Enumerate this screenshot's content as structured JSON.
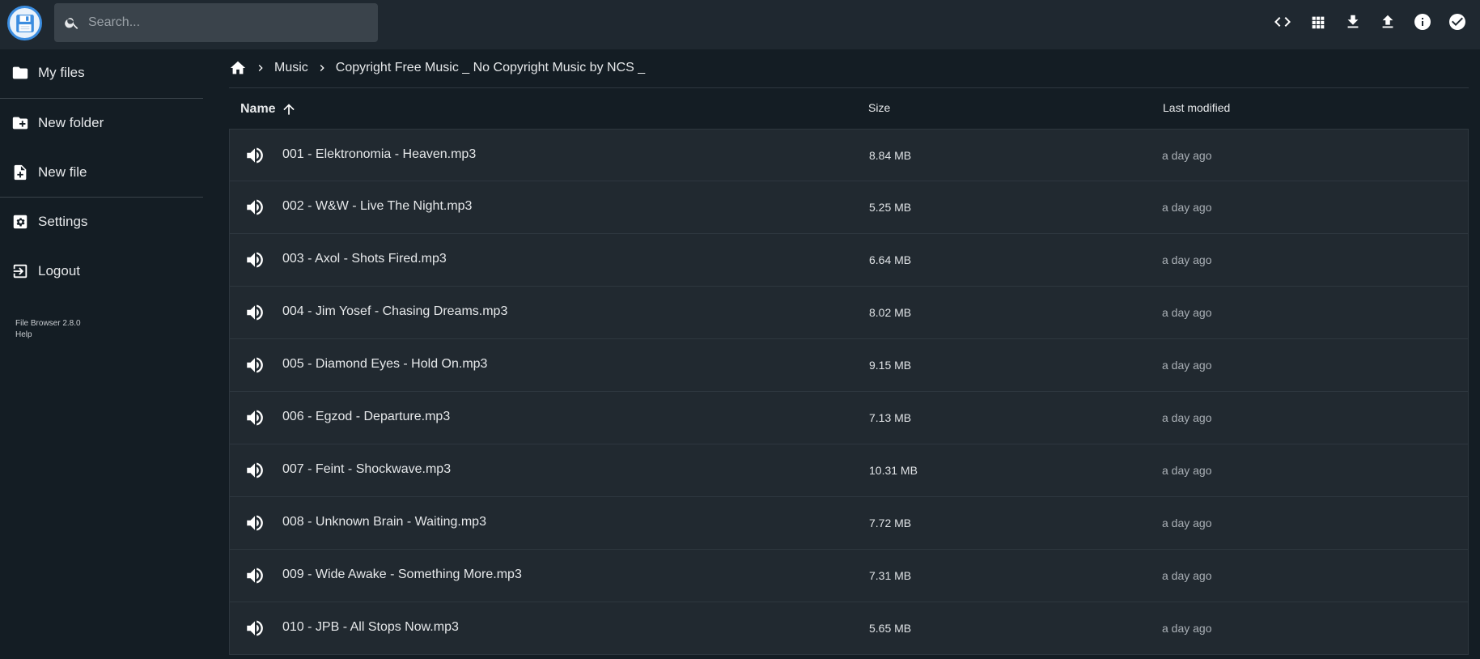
{
  "header": {
    "logo_icon": "floppy-disk-logo",
    "search": {
      "placeholder": "Search..."
    },
    "actions": [
      {
        "name": "code-icon"
      },
      {
        "name": "grid-view-icon"
      },
      {
        "name": "download-icon"
      },
      {
        "name": "upload-icon"
      },
      {
        "name": "info-icon"
      },
      {
        "name": "check-circle-icon"
      }
    ]
  },
  "sidebar": {
    "items": [
      {
        "label": "My files",
        "icon": "folder-icon"
      },
      {
        "label": "New folder",
        "icon": "new-folder-icon"
      },
      {
        "label": "New file",
        "icon": "new-file-icon"
      },
      {
        "label": "Settings",
        "icon": "settings-icon"
      },
      {
        "label": "Logout",
        "icon": "logout-icon"
      }
    ],
    "credits": {
      "version": "File Browser 2.8.0",
      "help": "Help"
    }
  },
  "breadcrumb": {
    "home_icon": "home-icon",
    "items": [
      "Music",
      "Copyright Free Music _ No Copyright Music by NCS _"
    ]
  },
  "table": {
    "headers": {
      "name": "Name",
      "size": "Size",
      "modified": "Last modified"
    },
    "sort": "name-ascending",
    "rows": [
      {
        "name": "001 - Elektronomia - Heaven.mp3",
        "size": "8.84 MB",
        "modified": "a day ago"
      },
      {
        "name": "002 - W&W - Live The Night.mp3",
        "size": "5.25 MB",
        "modified": "a day ago"
      },
      {
        "name": "003 - Axol - Shots Fired.mp3",
        "size": "6.64 MB",
        "modified": "a day ago"
      },
      {
        "name": "004 - Jim Yosef - Chasing Dreams.mp3",
        "size": "8.02 MB",
        "modified": "a day ago"
      },
      {
        "name": "005 - Diamond Eyes - Hold On.mp3",
        "size": "9.15 MB",
        "modified": "a day ago"
      },
      {
        "name": "006 - Egzod - Departure.mp3",
        "size": "7.13 MB",
        "modified": "a day ago"
      },
      {
        "name": "007 - Feint - Shockwave.mp3",
        "size": "10.31 MB",
        "modified": "a day ago"
      },
      {
        "name": "008 - Unknown Brain - Waiting.mp3",
        "size": "7.72 MB",
        "modified": "a day ago"
      },
      {
        "name": "009 - Wide Awake - Something More.mp3",
        "size": "7.31 MB",
        "modified": "a day ago"
      },
      {
        "name": "010 - JPB - All Stops Now.mp3",
        "size": "5.65 MB",
        "modified": "a day ago"
      }
    ]
  },
  "colors": {
    "background": "#141d24",
    "header": "#1f2830",
    "row": "#212930",
    "accent": "#3b8de0"
  }
}
